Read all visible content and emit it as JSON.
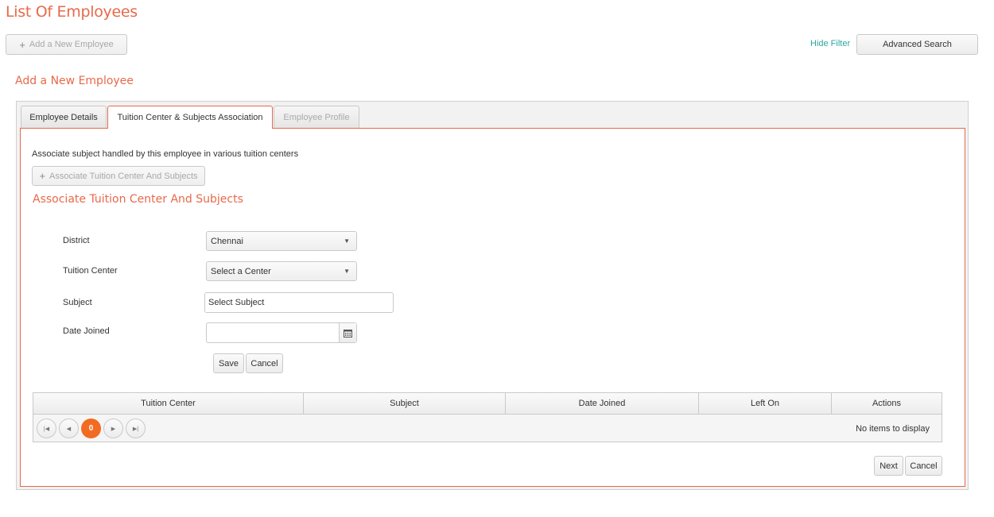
{
  "page": {
    "title": "List Of Employees"
  },
  "toolbar": {
    "add_employee_label": "Add a New Employee",
    "hide_filter_label": "Hide Filter",
    "advanced_search_label": "Advanced Search"
  },
  "section": {
    "title": "Add a New Employee"
  },
  "tabs": [
    {
      "label": "Employee Details",
      "state": "normal"
    },
    {
      "label": "Tuition Center & Subjects Association",
      "state": "active"
    },
    {
      "label": "Employee Profile",
      "state": "disabled"
    }
  ],
  "association": {
    "description": "Associate subject handled by this employee in various tuition centers",
    "associate_button_label": "Associate Tuition Center And Subjects",
    "subtitle": "Associate Tuition Center And Subjects"
  },
  "form": {
    "district": {
      "label": "District",
      "value": "Chennai"
    },
    "tuition_center": {
      "label": "Tuition Center",
      "value": "Select a Center"
    },
    "subject": {
      "label": "Subject",
      "value": "Select Subject"
    },
    "date_joined": {
      "label": "Date Joined",
      "value": ""
    },
    "save_label": "Save",
    "cancel_label": "Cancel"
  },
  "grid": {
    "columns": [
      "Tuition Center",
      "Subject",
      "Date Joined",
      "Left On",
      "Actions"
    ],
    "current_page": "0",
    "empty_message": "No items to display"
  },
  "footer": {
    "next_label": "Next",
    "cancel_label": "Cancel"
  },
  "colors": {
    "accent": "#e8694a",
    "link": "#2aa6a0",
    "pager_active": "#f26b22"
  }
}
